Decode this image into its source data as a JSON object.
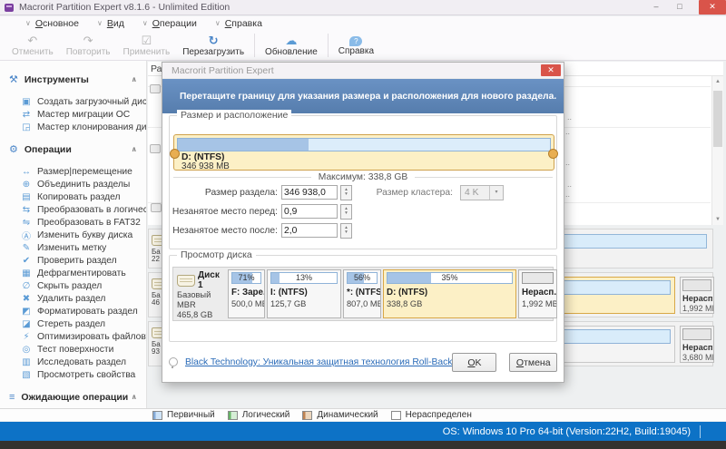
{
  "window": {
    "title": "Macrorit Partition Expert v8.1.6 - Unlimited Edition",
    "minimize": "–",
    "maximize": "□",
    "close": "✕"
  },
  "glyphs": {
    "menu_chevron": "∨",
    "collapse": "∧",
    "spin_up": "▴",
    "spin_down": "▾",
    "select_arrow": "▾",
    "scroll_up": "▲",
    "scroll_down": "▼",
    "cloud_up": "↑"
  },
  "menu": {
    "items": [
      {
        "label": "Основное"
      },
      {
        "label": "Вид"
      },
      {
        "label": "Операции"
      },
      {
        "label": "Справка"
      }
    ]
  },
  "toolbar": {
    "items": [
      {
        "label": "Отменить",
        "icon": "↶",
        "enabled": false
      },
      {
        "label": "Повторить",
        "icon": "↷",
        "enabled": false
      },
      {
        "label": "Применить",
        "icon": "☑",
        "enabled": false
      },
      {
        "label": "Перезагрузить",
        "icon": "↻",
        "enabled": true
      },
      {
        "label": "Обновление",
        "icon": "☁",
        "enabled": true
      },
      {
        "label": "Справка",
        "icon": "?",
        "enabled": true
      }
    ]
  },
  "sidebar": {
    "sections": [
      {
        "title": "Инструменты",
        "icon": "⚒",
        "items": [
          {
            "label": "Создать загрузочный диск",
            "icon": "▣"
          },
          {
            "label": "Мастер миграции ОС",
            "icon": "⇄"
          },
          {
            "label": "Мастер клонирования диска",
            "icon": "◲"
          }
        ]
      },
      {
        "title": "Операции",
        "icon": "⚙",
        "items": [
          {
            "label": "Размер|перемещение",
            "icon": "↔"
          },
          {
            "label": "Объединить разделы",
            "icon": "⊕"
          },
          {
            "label": "Копировать раздел",
            "icon": "▤"
          },
          {
            "label": "Преобразовать в логический",
            "icon": "⇆"
          },
          {
            "label": "Преобразовать в FAT32",
            "icon": "⇋"
          },
          {
            "label": "Изменить букву диска",
            "icon": "Ⓐ"
          },
          {
            "label": "Изменить метку",
            "icon": "✎"
          },
          {
            "label": "Проверить раздел",
            "icon": "✔"
          },
          {
            "label": "Дефрагментировать",
            "icon": "▦"
          },
          {
            "label": "Скрыть раздел",
            "icon": "∅"
          },
          {
            "label": "Удалить раздел",
            "icon": "✖"
          },
          {
            "label": "Форматировать раздел",
            "icon": "◩"
          },
          {
            "label": "Стереть раздел",
            "icon": "◪"
          },
          {
            "label": "Оптимизировать файлову...",
            "icon": "⚡"
          },
          {
            "label": "Тест поверхности",
            "icon": "◎"
          },
          {
            "label": "Исследовать раздел",
            "icon": "▥"
          },
          {
            "label": "Просмотреть свойства",
            "icon": "▧"
          }
        ]
      },
      {
        "title": "Ожидающие операции",
        "icon": "≡",
        "items": []
      }
    ]
  },
  "main": {
    "column_header": "Раз...",
    "fragment": "..",
    "disk_stubs": [
      {
        "type": "Ба",
        "size": "22"
      },
      {
        "type": "Ба",
        "size": "46"
      },
      {
        "type": "Ба",
        "size": "93"
      }
    ],
    "unallocated": [
      {
        "label": "Нерасп...",
        "size": "1,992 MB"
      },
      {
        "label": "Нерасп...",
        "size": "3,680 MB"
      }
    ]
  },
  "dialog": {
    "title": "Macrorit Partition Expert",
    "close": "✕",
    "banner": "Перетащите границу для указания размера и расположения для нового раздела.",
    "size_section": {
      "title": "Размер и расположение",
      "partition_label": "D: (NTFS)",
      "partition_size": "346 938 MB",
      "fill_percent": 35,
      "maximum": "Максимум: 338,8 GB",
      "fields": [
        {
          "label": "Размер раздела:",
          "value": "346 938,0"
        },
        {
          "label": "Незанятое место перед:",
          "value": "0,9"
        },
        {
          "label": "Незанятое место после:",
          "value": "2,0"
        }
      ],
      "cluster_label": "Размер кластера:",
      "cluster_value": "4 K"
    },
    "disk_section": {
      "title": "Просмотр диска",
      "disk_name": "Диск 1",
      "disk_type": "Базовый MBR",
      "disk_size": "465,8 GB",
      "partitions": [
        {
          "label": "F: Заре...",
          "size": "500,0 MB",
          "percent_label": "71%",
          "fill_percent": 71
        },
        {
          "label": "I: (NTFS)",
          "size": "125,7 GB",
          "percent_label": "13%",
          "fill_percent": 13
        },
        {
          "label": "*: (NTFS)",
          "size": "807,0 MB",
          "percent_label": "56%",
          "fill_percent": 56
        },
        {
          "label": "D: (NTFS)",
          "size": "338,8 GB",
          "percent_label": "35%",
          "fill_percent": 35
        },
        {
          "label": "Нерасп...",
          "size": "1,992 MB",
          "percent_label": "",
          "fill_percent": 0
        }
      ]
    },
    "footer": {
      "link": "Black Technology: Уникальная защитная технология Roll-Back",
      "ok": "OK",
      "cancel": "Отмена"
    }
  },
  "legend": {
    "items": [
      {
        "label": "Первичный",
        "color": "#cfe4f8",
        "accent": "#85abd8"
      },
      {
        "label": "Логический",
        "color": "#d6eed6",
        "accent": "#67b567"
      },
      {
        "label": "Динамический",
        "color": "#ecd6bd",
        "accent": "#bf8352"
      },
      {
        "label": "Нераспределен",
        "color": "#ffffff",
        "accent": "#ffffff"
      }
    ]
  },
  "statusbar": {
    "os_info": "OS: Windows 10 Pro 64-bit (Version:22H2, Build:19045)"
  },
  "colors": {
    "status_blue": "#0d72c6",
    "banner_blue": "#5e86b8",
    "selection_yellow": "#fcf0c6",
    "bar_fill_blue": "#a6c4e6",
    "close_red": "#d9544a"
  }
}
